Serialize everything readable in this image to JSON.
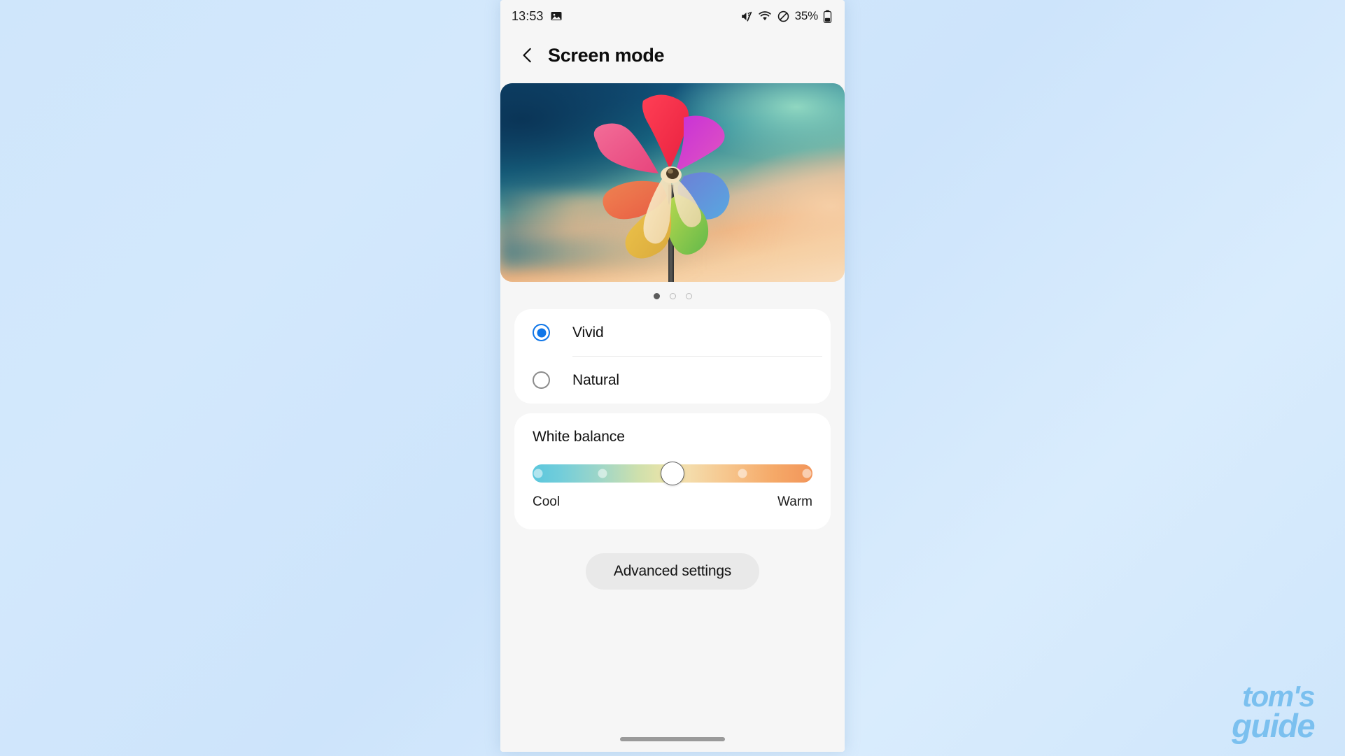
{
  "watermark": {
    "line1": "tom's",
    "line2": "guide"
  },
  "statusbar": {
    "time": "13:53",
    "battery_percent": "35%",
    "icons": [
      "image-icon",
      "mute-icon",
      "wifi-icon",
      "do-not-disturb-icon",
      "battery-icon"
    ]
  },
  "header": {
    "back_icon": "back-chevron-icon",
    "title": "Screen mode"
  },
  "preview": {
    "image_alt": "colorful-pinwheel-sunset-preview",
    "dots": {
      "count": 3,
      "active_index": 0
    }
  },
  "screen_modes": {
    "selected": "Vivid",
    "options": [
      {
        "label": "Vivid",
        "checked": true
      },
      {
        "label": "Natural",
        "checked": false
      }
    ]
  },
  "white_balance": {
    "title": "White balance",
    "cool_label": "Cool",
    "warm_label": "Warm",
    "thumb_percent": 50,
    "tick_percents": [
      2,
      25,
      50,
      75,
      98
    ],
    "gradient_cool": "#5bc7dd",
    "gradient_warm": "#f2955a"
  },
  "advanced_button": {
    "label": "Advanced settings"
  },
  "colors": {
    "accent": "#0f76e8",
    "page_bg": "#f6f6f6",
    "card_bg": "#ffffff",
    "wallpaper_bg": "#cfe6fb",
    "watermark": "#7bc0ef"
  },
  "home_indicator": {
    "name": "home-indicator"
  }
}
